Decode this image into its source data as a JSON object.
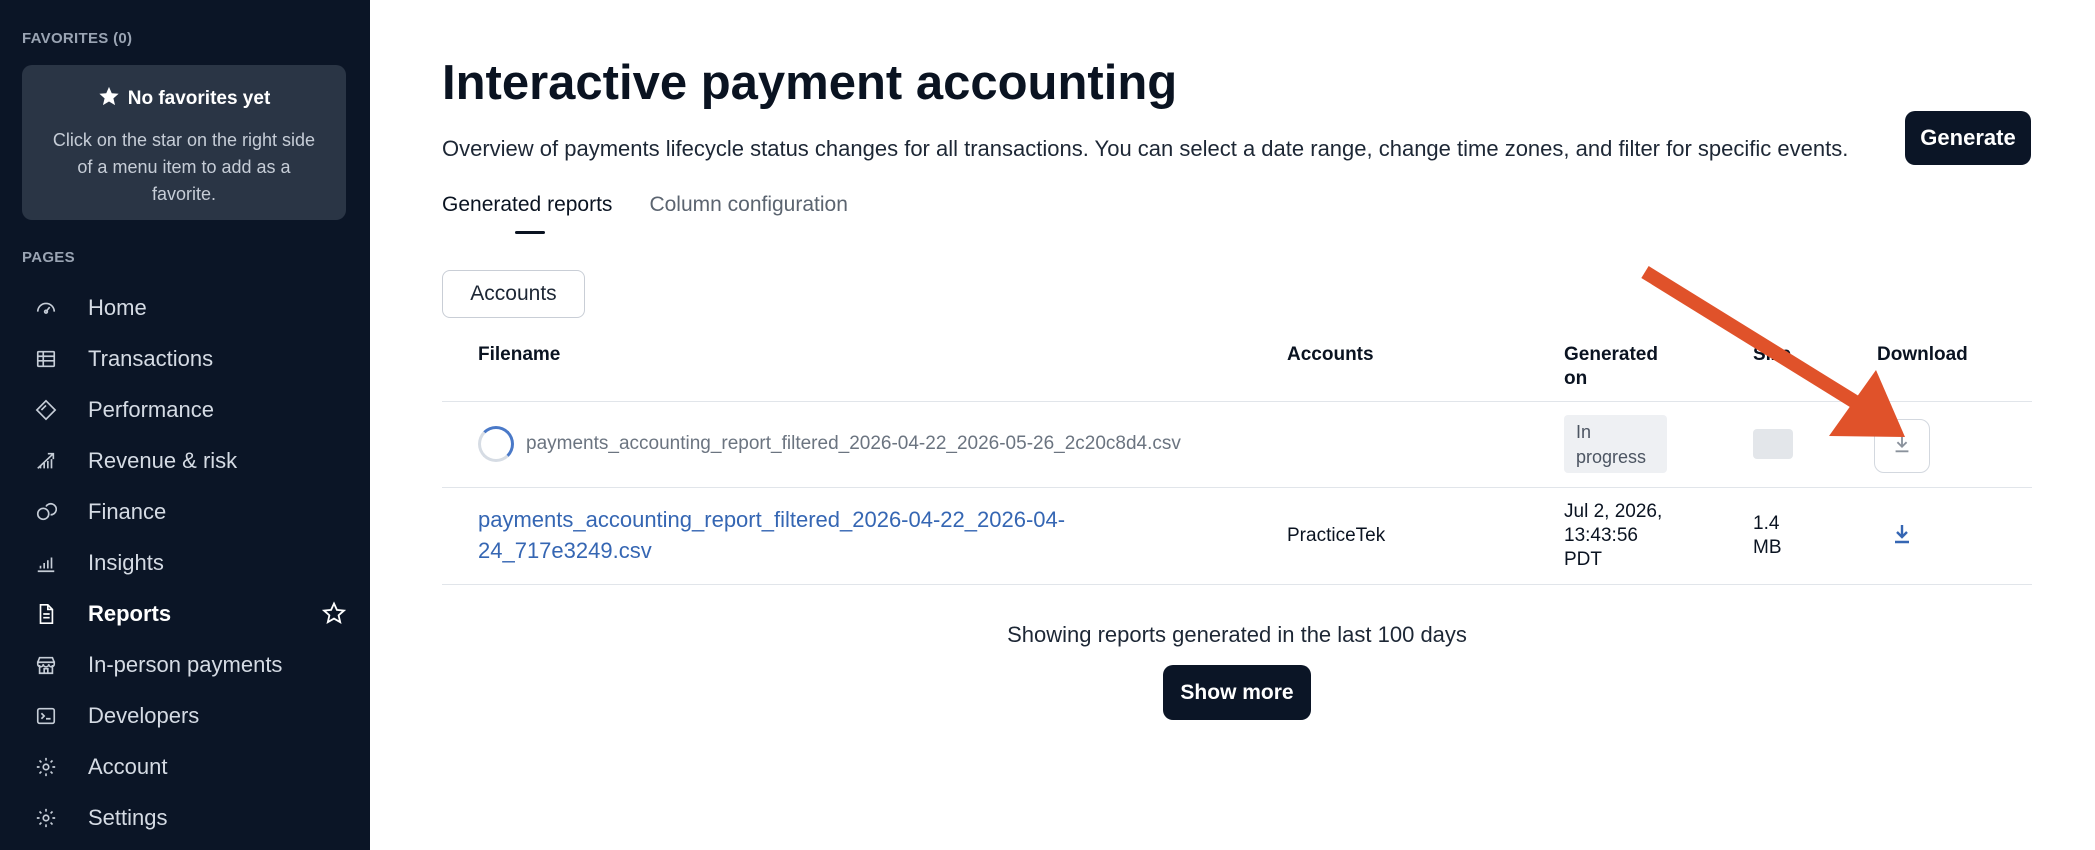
{
  "sidebar": {
    "favorites_label": "FAVORITES (0)",
    "favorites_empty_title": "No favorites yet",
    "favorites_empty_desc": "Click on the star on the right side of a menu item to add as a favorite.",
    "pages_label": "PAGES",
    "items": [
      {
        "label": "Home",
        "icon": "gauge-icon"
      },
      {
        "label": "Transactions",
        "icon": "table-icon"
      },
      {
        "label": "Performance",
        "icon": "diamond-icon"
      },
      {
        "label": "Revenue & risk",
        "icon": "trend-icon"
      },
      {
        "label": "Finance",
        "icon": "coins-icon"
      },
      {
        "label": "Insights",
        "icon": "bar-chart-icon"
      },
      {
        "label": "Reports",
        "icon": "document-icon",
        "active": true
      },
      {
        "label": "In-person payments",
        "icon": "store-icon"
      },
      {
        "label": "Developers",
        "icon": "terminal-icon"
      },
      {
        "label": "Account",
        "icon": "gear-icon"
      },
      {
        "label": "Settings",
        "icon": "gear-icon"
      }
    ]
  },
  "main": {
    "title": "Interactive payment accounting",
    "description": "Overview of payments lifecycle status changes for all transactions. You can select a date range, change time zones, and filter for specific events.",
    "generate_label": "Generate",
    "tabs": [
      {
        "label": "Generated reports",
        "active": true
      },
      {
        "label": "Column configuration",
        "active": false
      }
    ],
    "filter_label": "Accounts",
    "table": {
      "headers": {
        "filename": "Filename",
        "accounts": "Accounts",
        "generated_line1": "Generated",
        "generated_line2": "on",
        "size": "Size",
        "download": "Download"
      },
      "rows": [
        {
          "filename": "payments_accounting_report_filtered_2026-04-22_2026-05-26_2c20c8d4.csv",
          "accounts": "",
          "status_line1": "In",
          "status_line2": "progress"
        },
        {
          "filename_line1": "payments_accounting_report_filtered_2026-04-22_2026-04-",
          "filename_line2": "24_717e3249.csv",
          "accounts": "PracticeTek",
          "generated_line1": "Jul 2, 2026,",
          "generated_line2": "13:43:56",
          "generated_line3": "PDT",
          "size_line1": "1.4",
          "size_line2": "MB"
        }
      ]
    },
    "footer_text": "Showing reports generated in the last 100 days",
    "show_more_label": "Show more"
  },
  "colors": {
    "sidebar_bg": "#0b1526",
    "link": "#3566b3",
    "annotation_arrow": "#e0522a"
  }
}
